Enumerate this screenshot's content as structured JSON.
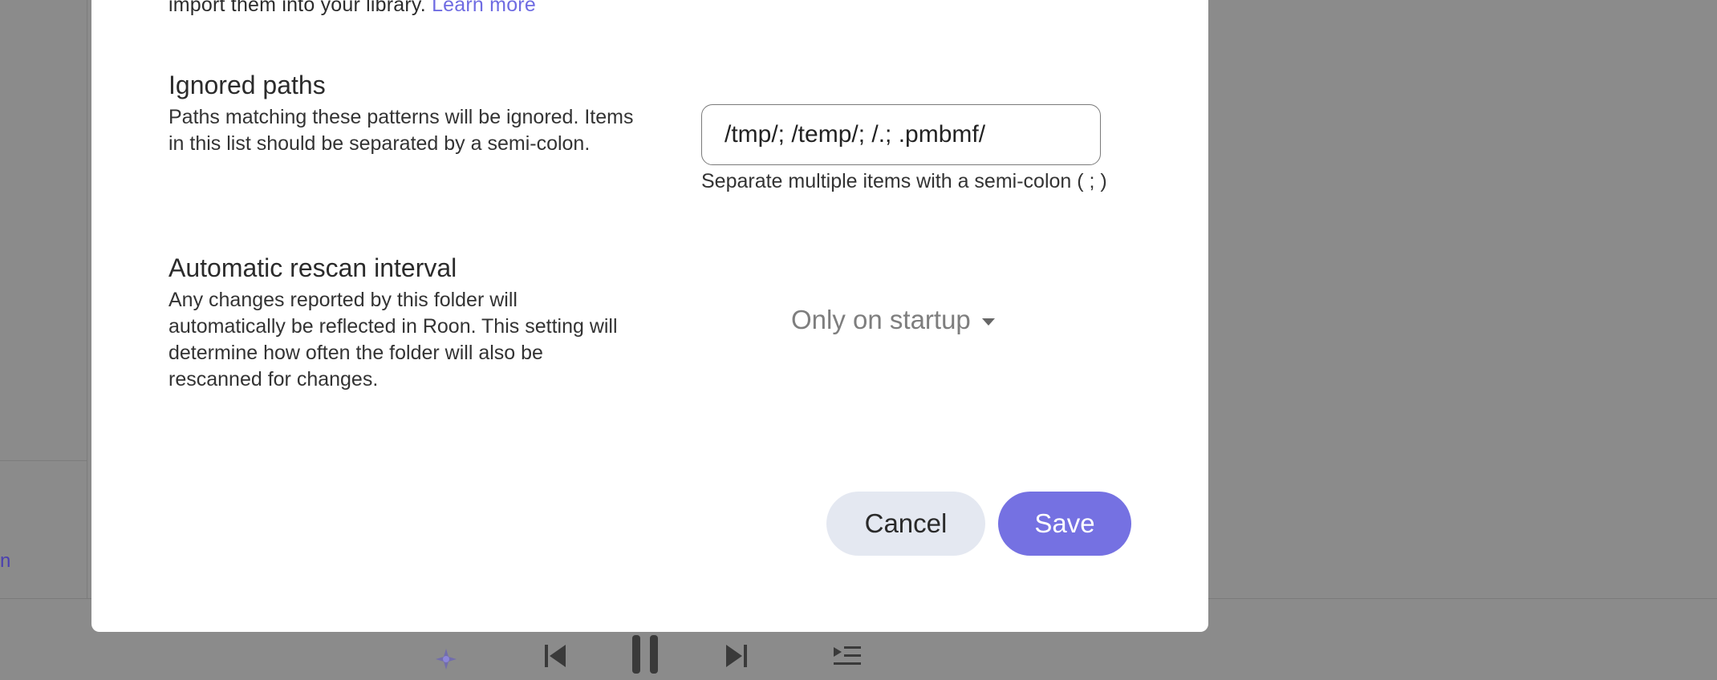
{
  "background": {
    "sidebar_link_fragment": "n"
  },
  "transport": {
    "radiance_icon": "radiance-icon",
    "prev_icon": "previous-track-icon",
    "pause_icon": "pause-icon",
    "next_icon": "next-track-icon",
    "queue_icon": "queue-icon"
  },
  "modal": {
    "intro_text": "import them into your library.",
    "intro_link": "Learn more",
    "ignored_paths": {
      "title": "Ignored paths",
      "description": "Paths matching these patterns will be ignored. Items in this list should be separated by a semi-colon.",
      "value": "/tmp/; /temp/; /.; .pmbmf/",
      "help": "Separate multiple items with a semi-colon ( ; )"
    },
    "rescan": {
      "title": "Automatic rescan interval",
      "description": "Any changes reported by this folder will automatically be reflected in Roon. This setting will determine how often the folder will also be rescanned for changes.",
      "selected": "Only on startup"
    },
    "cancel_label": "Cancel",
    "save_label": "Save"
  },
  "colors": {
    "accent": "#7571e2",
    "cancel_bg": "#e4e8f1",
    "overlay": "#8b8b8b"
  }
}
